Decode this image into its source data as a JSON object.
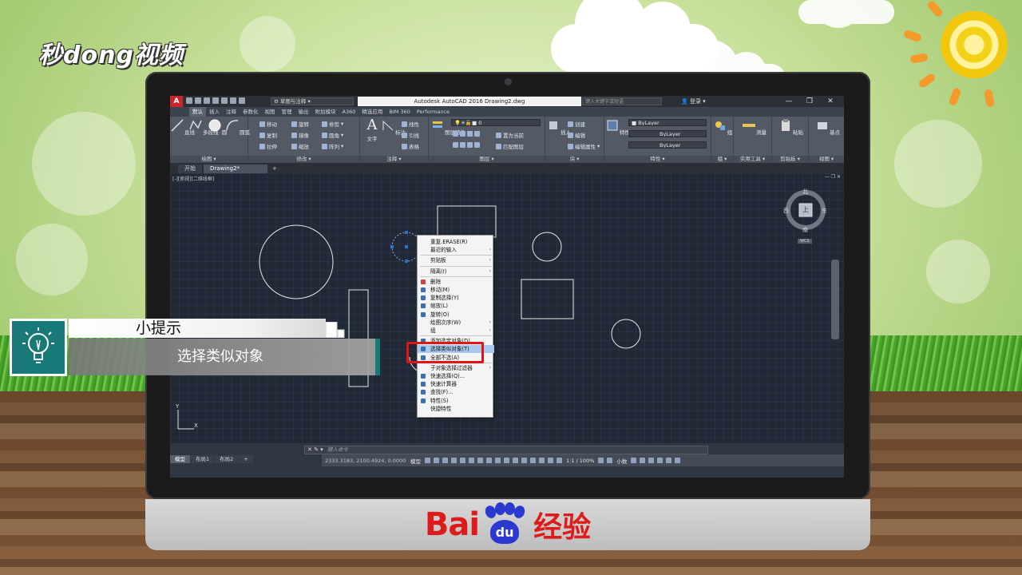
{
  "watermark": "秒dong视频",
  "app": {
    "workspace": "草图与注释",
    "title": "Autodesk AutoCAD 2016    Drawing2.dwg",
    "search_placeholder": "键入关键字或短语",
    "login": "登录",
    "window_buttons": [
      "—",
      "❐",
      "✕"
    ]
  },
  "ribbon_tabs": [
    "默认",
    "插入",
    "注释",
    "参数化",
    "视图",
    "管理",
    "输出",
    "附加模块",
    "A360",
    "精选应用",
    "BIM 360",
    "Performance"
  ],
  "ribbon": {
    "draw": {
      "title": "绘图",
      "tools": [
        "直线",
        "多段线",
        "圆",
        "圆弧"
      ]
    },
    "modify": {
      "title": "修改",
      "tools": [
        "移动",
        "旋转",
        "修剪",
        "复制",
        "镜像",
        "圆角",
        "拉伸",
        "缩放",
        "阵列"
      ]
    },
    "annotation": {
      "title": "注释",
      "tools": [
        "文字",
        "标注",
        "线性",
        "引线",
        "表格"
      ]
    },
    "layers": {
      "title": "图层",
      "tools": [
        "图层特性",
        "置为当前",
        "匹配图层"
      ],
      "layer_value": "0"
    },
    "block": {
      "title": "块",
      "tools": [
        "插入",
        "创建",
        "编辑",
        "编辑属性"
      ]
    },
    "properties": {
      "title": "特性",
      "tools": [
        "特性匹配"
      ],
      "values": [
        "ByLayer",
        "ByLayer",
        "ByLayer"
      ]
    },
    "groups": {
      "title": "组",
      "tools": [
        "组"
      ]
    },
    "utilities": {
      "title": "实用工具",
      "tools": [
        "测量"
      ]
    },
    "clipboard": {
      "title": "剪贴板",
      "tools": [
        "粘贴"
      ]
    },
    "view": {
      "title": "视图",
      "tools": [
        "基点"
      ]
    }
  },
  "file_tabs": [
    "开始",
    "Drawing2*",
    "+"
  ],
  "viewport_label": "[-][俯视][二维线框]",
  "viewcube": {
    "north": "北",
    "south": "南",
    "west": "西",
    "east": "东",
    "top": "上",
    "wcs": "WCS"
  },
  "context_menu": {
    "items": [
      {
        "label": "重复.ERASE(R)",
        "submenu": false
      },
      {
        "label": "最近的输入",
        "submenu": true
      },
      {
        "label": "剪贴板",
        "submenu": true
      },
      {
        "label": "隔离(I)",
        "submenu": true
      },
      {
        "label": "删除",
        "submenu": false,
        "icon": "#d04040"
      },
      {
        "label": "移动(M)",
        "submenu": false,
        "icon": "#3b6fb5"
      },
      {
        "label": "复制选择(Y)",
        "submenu": false,
        "icon": "#3b6fb5"
      },
      {
        "label": "缩放(L)",
        "submenu": false,
        "icon": "#3b6fb5"
      },
      {
        "label": "旋转(O)",
        "submenu": false,
        "icon": "#3b6fb5"
      },
      {
        "label": "绘图次序(W)",
        "submenu": true
      },
      {
        "label": "组",
        "submenu": true
      },
      {
        "label": "添加选定对象(D)",
        "submenu": false,
        "icon": "#3b6fb5"
      },
      {
        "label": "选择类似对象(T)",
        "submenu": false,
        "icon": "#3b6fb5",
        "highlighted": true
      },
      {
        "label": "全部不选(A)",
        "submenu": false,
        "icon": "#3b6fb5"
      },
      {
        "label": "子对象选择过滤器",
        "submenu": true
      },
      {
        "label": "快速选择(Q)...",
        "submenu": false,
        "icon": "#3b6fb5"
      },
      {
        "label": "快速计算器",
        "submenu": false,
        "icon": "#3b6fb5"
      },
      {
        "label": "查找(F)...",
        "submenu": false,
        "icon": "#3b6fb5"
      },
      {
        "label": "特性(S)",
        "submenu": false,
        "icon": "#3b6fb5"
      },
      {
        "label": "快捷特性",
        "submenu": false
      }
    ]
  },
  "command_line": {
    "prefix": "✕ ✎ ▾",
    "placeholder": "键入命令"
  },
  "layout_tabs": [
    "模型",
    "布局1",
    "布局2",
    "+"
  ],
  "status": {
    "coords": "2333.3183, 2100.4924, 0.0000",
    "model": "模型",
    "scale": "1:1 / 100%",
    "units": "小数"
  },
  "tip": {
    "title": "小提示",
    "text": "选择类似对象"
  },
  "branding": {
    "bai": "Bai",
    "du": "du",
    "cn": "经验"
  },
  "colors": {
    "accent_teal": "#187a78",
    "highlight_red": "#e31414",
    "menu_highlight": "#a9c9ee",
    "canvas": "#212836",
    "autocad_red": "#c9252b"
  }
}
